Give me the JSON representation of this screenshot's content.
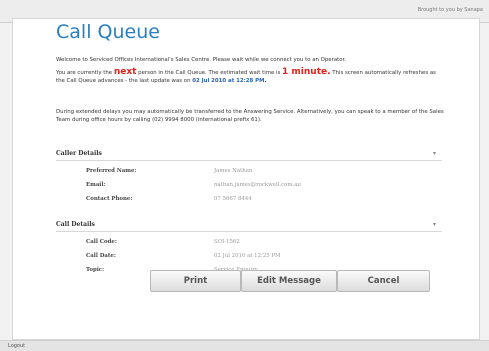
{
  "header": {
    "brought": "Brought to you by Sanapa"
  },
  "page": {
    "title": "Call Queue",
    "welcome": "Welcome to Serviced Offices International's Sales Centre. Please wait while we connect you to an Operator.",
    "queue": {
      "pre": "You are currently the ",
      "position": "next",
      "mid": " person in the Call Queue. The estimated wait time is ",
      "wait": "1 minute.",
      "post": " This screen automatically refreshes as the Call Queue advances - the last update was on ",
      "updated": "02 Jul 2010 at 12:28 PM."
    },
    "delay_note": "During extended delays you may automatically be transferred to the Answering Service. Alternatively, you can speak to a member of the Sales Team during office hours by calling (02) 9994 8000 (international prefix 61)."
  },
  "caller": {
    "heading": "Caller Details",
    "rows": [
      {
        "label": "Preferred Name:",
        "value": "James Nathan"
      },
      {
        "label": "Email:",
        "value": "nathan.james@rockwell.com.au"
      },
      {
        "label": "Contact Phone:",
        "value": "07 5667 8444"
      }
    ]
  },
  "call": {
    "heading": "Call Details",
    "rows": [
      {
        "label": "Call Code:",
        "value": "SOI-1562"
      },
      {
        "label": "Call Date:",
        "value": "02 Jul 2010 at 12:25 PM"
      },
      {
        "label": "Topic:",
        "value": "Service Enquiry"
      }
    ]
  },
  "buttons": {
    "print": "Print",
    "edit": "Edit Message",
    "cancel": "Cancel"
  },
  "footer": {
    "logout": "Logout"
  }
}
